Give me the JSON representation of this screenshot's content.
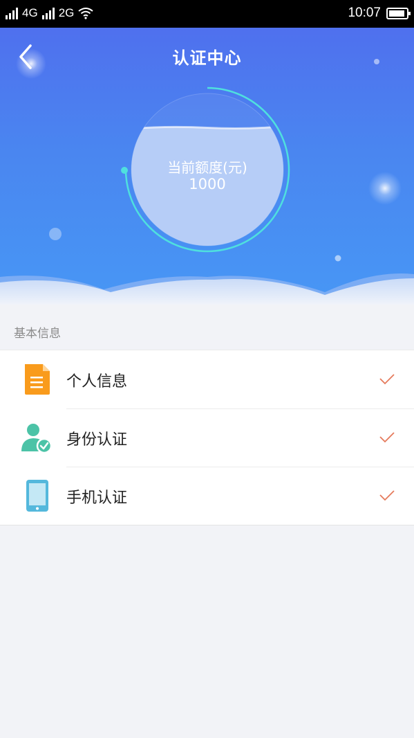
{
  "status_bar": {
    "network_1": "4G",
    "network_2": "2G",
    "time": "10:07"
  },
  "header": {
    "title": "认证中心"
  },
  "quota": {
    "label": "当前额度(元)",
    "value": "1000",
    "ring_progress": 0.75
  },
  "section": {
    "title": "基本信息"
  },
  "items": [
    {
      "label": "个人信息",
      "icon": "document-icon",
      "verified": true
    },
    {
      "label": "身份认证",
      "icon": "user-check-icon",
      "verified": true
    },
    {
      "label": "手机认证",
      "icon": "phone-icon",
      "verified": true
    }
  ],
  "colors": {
    "accent_blue": "#4a86f0",
    "ring": "#4fe0de",
    "doc_orange": "#f99b1c",
    "user_teal": "#4cc3a7",
    "phone_blue": "#54b8dc",
    "check": "#e57a5c"
  }
}
